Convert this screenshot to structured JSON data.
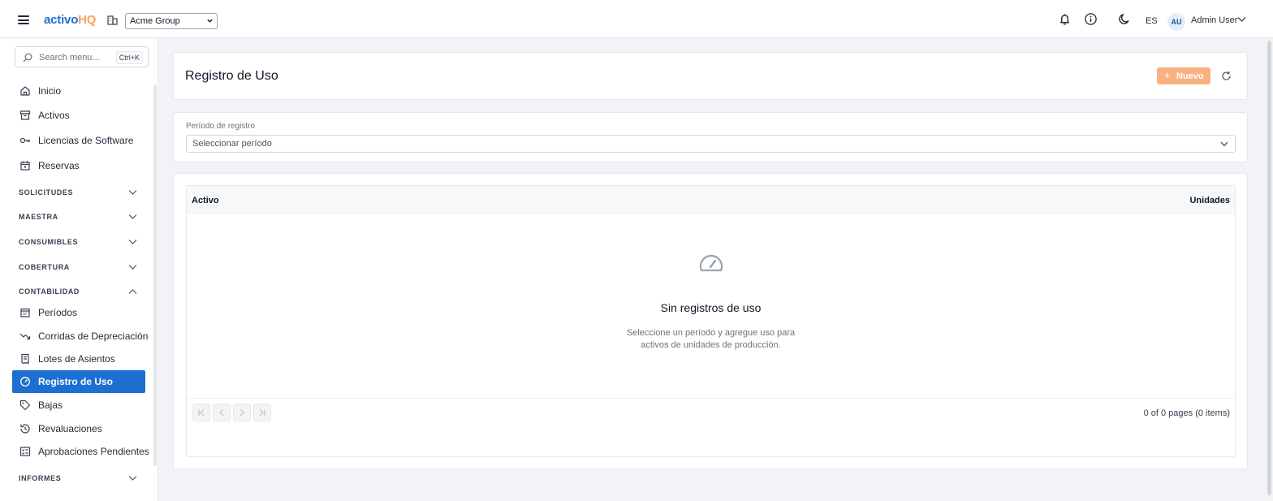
{
  "header": {
    "logo_part1": "activo",
    "logo_part2": "HQ",
    "org_selected": "Acme Group",
    "language": "ES",
    "avatar_initials": "AU",
    "user_name": "Admin User",
    "brand_color": "#1d6fd1",
    "accent_color": "#f4a261"
  },
  "sidebar": {
    "search_placeholder": "Search menu...",
    "search_shortcut": "Ctrl+K",
    "items": [
      {
        "label": "Inicio",
        "icon": "home-icon"
      },
      {
        "label": "Activos",
        "icon": "archive-icon"
      },
      {
        "label": "Licencias de Software",
        "icon": "key-icon"
      },
      {
        "label": "Reservas",
        "icon": "calendar-icon"
      }
    ],
    "sections": {
      "solicitudes": "SOLICITUDES",
      "maestra": "MAESTRA",
      "consumibles": "CONSUMIBLES",
      "cobertura": "COBERTURA",
      "contabilidad": "CONTABILIDAD",
      "informes": "INFORMES"
    },
    "accounting_items": [
      {
        "label": "Períodos",
        "icon": "calendar-grid-icon"
      },
      {
        "label": "Corridas de Depreciación",
        "icon": "trending-down-icon"
      },
      {
        "label": "Lotes de Asientos",
        "icon": "receipt-icon"
      },
      {
        "label": "Registro de Uso",
        "icon": "gauge-icon",
        "active": true
      },
      {
        "label": "Bajas",
        "icon": "tag-icon"
      },
      {
        "label": "Revaluaciones",
        "icon": "refresh-clock-icon"
      },
      {
        "label": "Aprobaciones Pendientes",
        "icon": "checklist-icon"
      }
    ]
  },
  "main": {
    "title": "Registro de Uso",
    "new_button": "Nuevo",
    "period_label": "Período de registro",
    "period_placeholder": "Seleccionar período",
    "columns": {
      "asset": "Activo",
      "units": "Unidades"
    },
    "empty_title": "Sin registros de uso",
    "empty_line1": "Seleccione un período y agregue uso para",
    "empty_line2": "activos de unidades de producción.",
    "pager_info": "0 of 0 pages (0 items)"
  }
}
